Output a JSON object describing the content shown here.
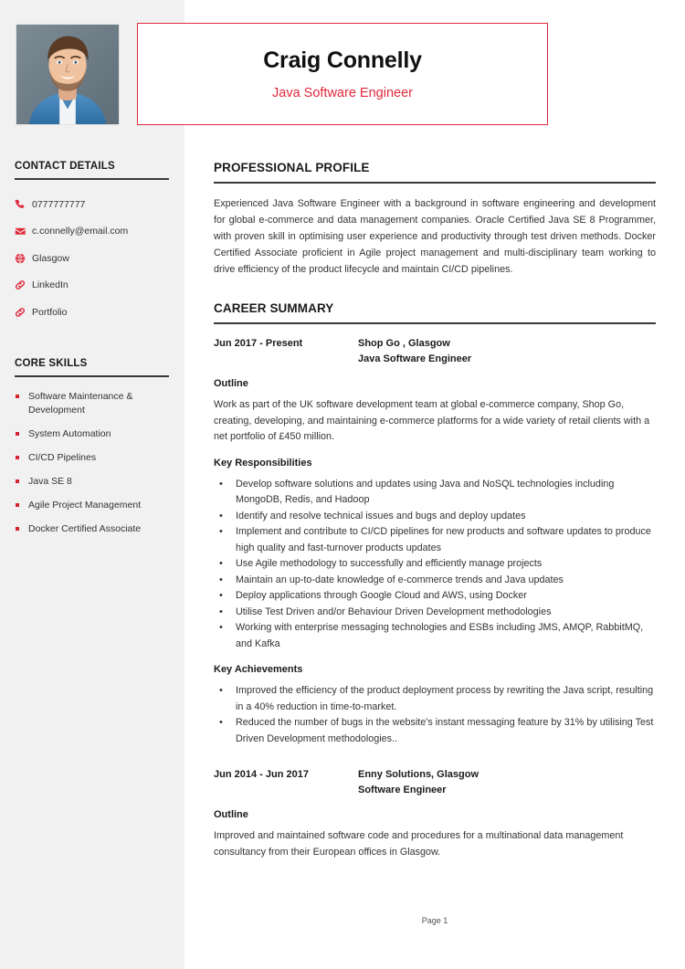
{
  "header": {
    "name": "Craig Connelly",
    "title": "Java Software Engineer",
    "accent_color": "#e0293c",
    "photo_alt": "profile-photo"
  },
  "sidebar": {
    "contact": {
      "heading": "CONTACT DETAILS",
      "items": [
        {
          "icon": "phone-icon",
          "text": "0777777777"
        },
        {
          "icon": "envelope-icon",
          "text": "c.connelly@email.com"
        },
        {
          "icon": "globe-icon",
          "text": "Glasgow"
        },
        {
          "icon": "link-icon",
          "text": "LinkedIn"
        },
        {
          "icon": "link-icon",
          "text": "Portfolio"
        }
      ]
    },
    "skills": {
      "heading": "CORE SKILLS",
      "items": [
        "Software Maintenance & Development",
        "System Automation",
        "CI/CD Pipelines",
        "Java SE 8",
        "Agile Project Management",
        "Docker Certified Associate"
      ]
    }
  },
  "main": {
    "profile": {
      "heading": "PROFESSIONAL PROFILE",
      "text": "Experienced Java Software Engineer with a background in software engineering and development for global e-commerce and data management companies. Oracle Certified Java SE 8 Programmer, with proven skill in optimising user experience and productivity through test driven methods. Docker Certified Associate proficient in Agile project management and multi-disciplinary team working to drive efficiency of the product lifecycle and maintain CI/CD pipelines."
    },
    "career": {
      "heading": "CAREER SUMMARY",
      "jobs": [
        {
          "dates": "Jun 2017 - Present",
          "company": "Shop Go , Glasgow",
          "role": "Java Software Engineer",
          "outline_label": "Outline",
          "outline": "Work as part of the UK software development team at global e-commerce company, Shop Go, creating, developing, and maintaining e-commerce platforms for a wide variety of retail clients with a net portfolio of £450 million.",
          "responsibilities_label": "Key Responsibilities",
          "responsibilities": [
            "Develop software solutions and updates using Java and NoSQL technologies including MongoDB, Redis, and Hadoop",
            "Identify and resolve technical issues and bugs and deploy updates",
            "Implement and contribute to CI/CD pipelines for new products and software updates to produce high quality and fast-turnover products updates",
            "Use Agile methodology to successfully and efficiently manage projects",
            "Maintain an up-to-date knowledge of e-commerce trends and Java updates",
            "Deploy applications through Google Cloud and AWS, using Docker",
            "Utilise Test Driven and/or Behaviour Driven Development methodologies",
            "Working with enterprise messaging technologies and ESBs including JMS, AMQP, RabbitMQ, and Kafka"
          ],
          "achievements_label": "Key Achievements",
          "achievements": [
            "Improved the efficiency of the product deployment process by rewriting the Java script, resulting in a 40% reduction in time-to-market.",
            "Reduced the number of bugs in the website's instant messaging feature by 31% by utilising Test Driven Development methodologies.."
          ]
        },
        {
          "dates": "Jun 2014 - Jun 2017",
          "company": "Enny Solutions, Glasgow",
          "role": "Software Engineer",
          "outline_label": "Outline",
          "outline": "Improved and maintained software code and procedures for a multinational data management consultancy from their European offices in Glasgow."
        }
      ]
    }
  },
  "footer": {
    "page_label": "Page 1"
  }
}
